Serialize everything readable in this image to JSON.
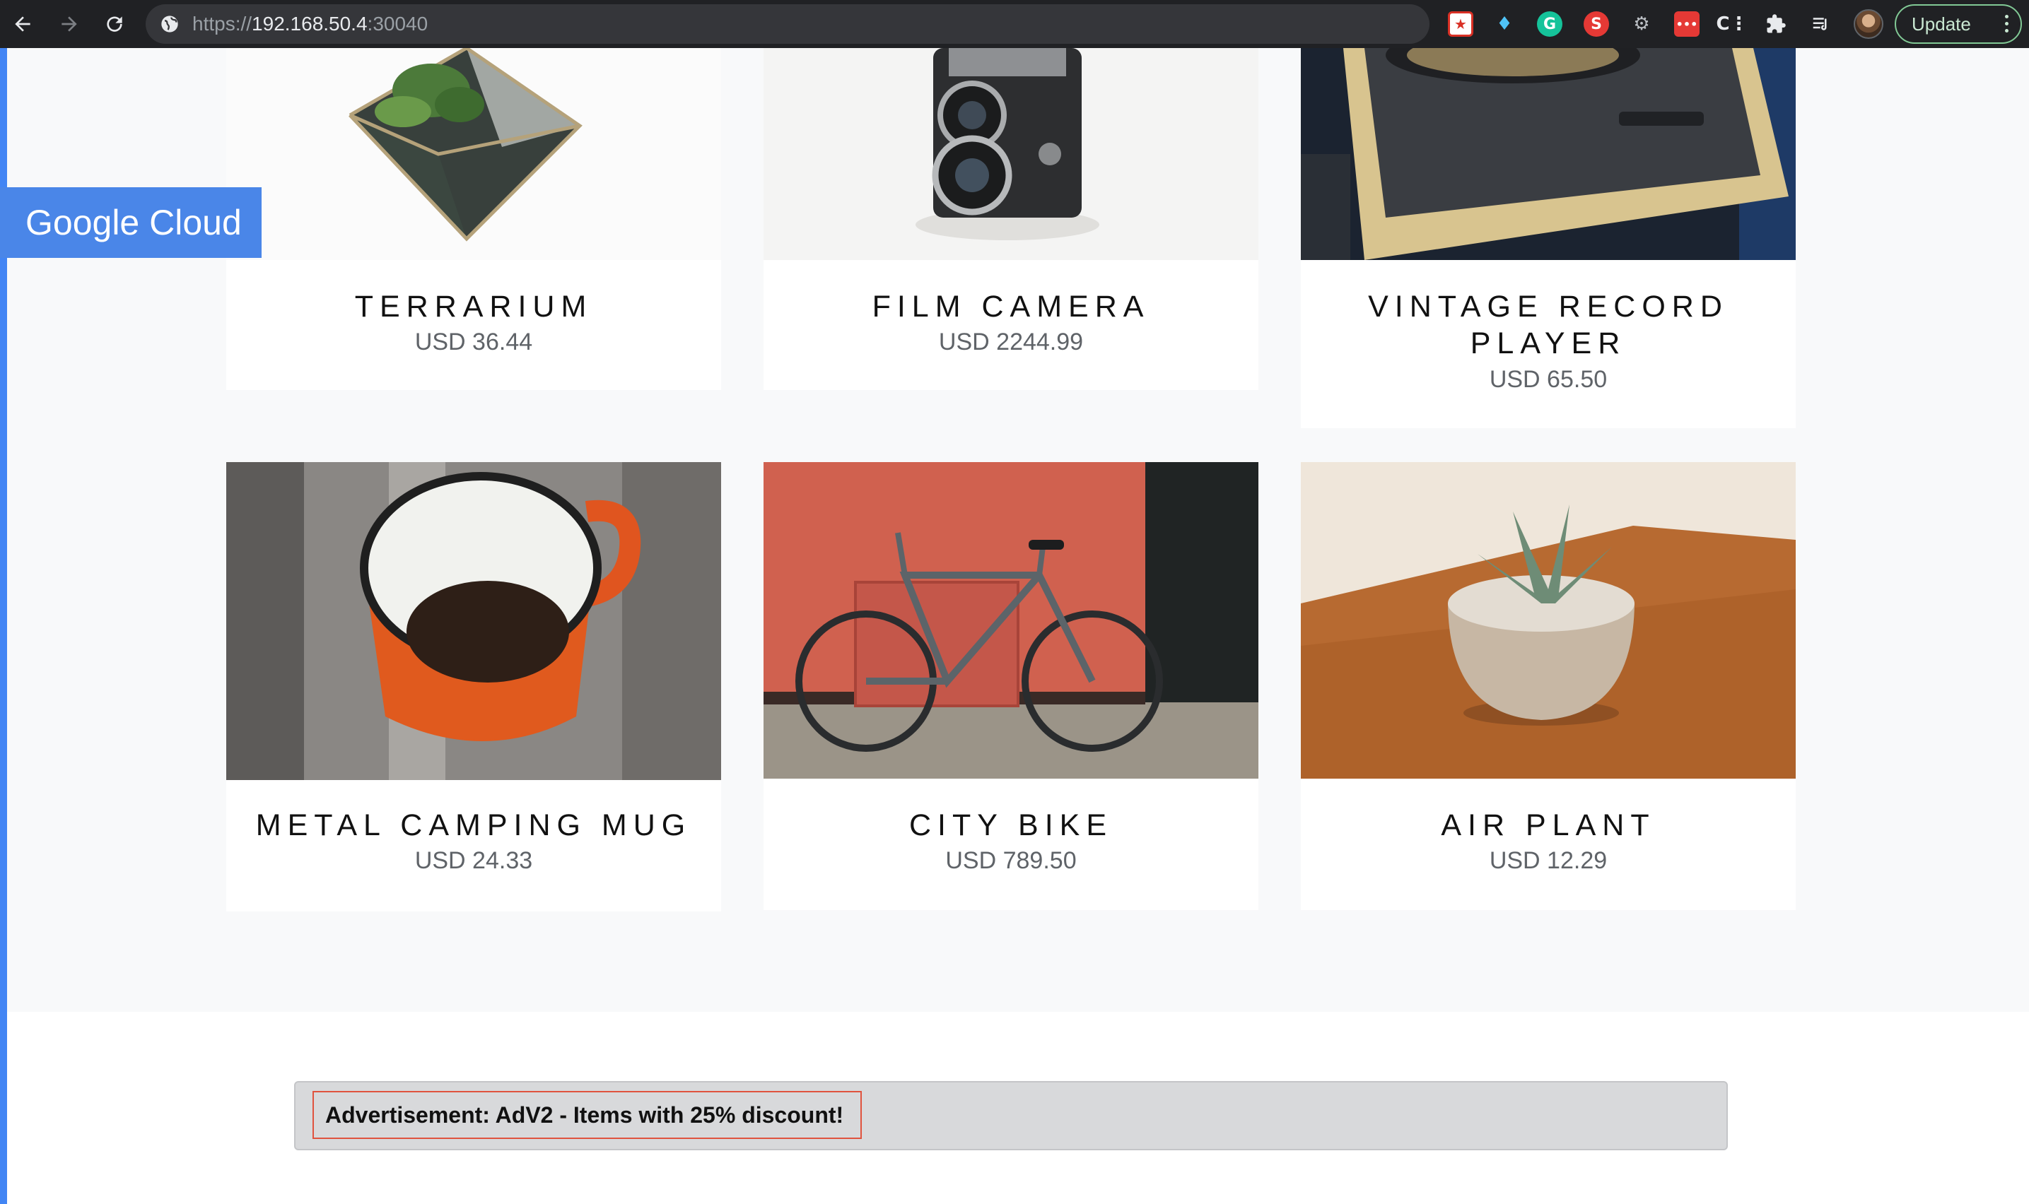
{
  "browser": {
    "url_prefix": "https://",
    "url_host": "192.168.50.4",
    "url_port": ":30040",
    "update_label": "Update",
    "extensions": [
      "bookmark-star-extension",
      "gem-extension",
      "grammarly-extension",
      "s-extension",
      "robot-extension",
      "dots-extension",
      "code-extension",
      "puzzle-extensions-icon",
      "reading-list-icon"
    ]
  },
  "page": {
    "brand_badge": "Google Cloud",
    "accent_color": "#4285f4"
  },
  "products": [
    {
      "name": "TERRARIUM",
      "price": "USD 36.44"
    },
    {
      "name": "FILM CAMERA",
      "price": "USD 2244.99"
    },
    {
      "name": "VINTAGE RECORD PLAYER",
      "price": "USD 65.50"
    },
    {
      "name": "METAL CAMPING MUG",
      "price": "USD 24.33"
    },
    {
      "name": "CITY BIKE",
      "price": "USD 789.50"
    },
    {
      "name": "AIR PLANT",
      "price": "USD 12.29"
    }
  ],
  "advertisement": {
    "text": "Advertisement: AdV2 - Items with 25% discount!"
  }
}
